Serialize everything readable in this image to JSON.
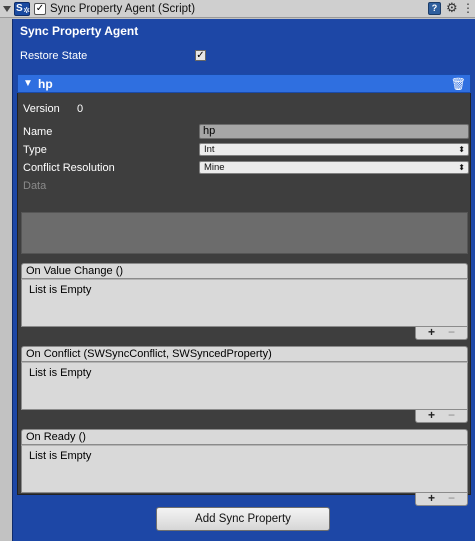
{
  "component": {
    "title": "Sync Property Agent (Script)",
    "script_icon_text": "S",
    "enabled_check": "✓",
    "help_glyph": "?",
    "settings_glyph": "⚙"
  },
  "agent": {
    "title": "Sync Property Agent",
    "restore_state_label": "Restore State",
    "restore_state_check": "✓"
  },
  "property": {
    "name_header": "hp",
    "version_label": "Version",
    "version_value": "0",
    "name_label": "Name",
    "name_value": "hp",
    "type_label": "Type",
    "type_value": "Int",
    "conflict_label": "Conflict Resolution",
    "conflict_value": "Mine",
    "data_label": "Data"
  },
  "events": [
    {
      "header": "On Value Change ()",
      "body": "List is Empty"
    },
    {
      "header": "On Conflict (SWSyncConflict, SWSyncedProperty)",
      "body": "List is Empty"
    },
    {
      "header": "On Ready ()",
      "body": "List is Empty"
    }
  ],
  "buttons": {
    "add_sync_property": "Add Sync Property",
    "plus": "+",
    "minus": "−"
  },
  "colors": {
    "panel_blue": "#1d47a6",
    "element_header_blue": "#2f6fe0",
    "dark_body": "#3e3e3e"
  }
}
